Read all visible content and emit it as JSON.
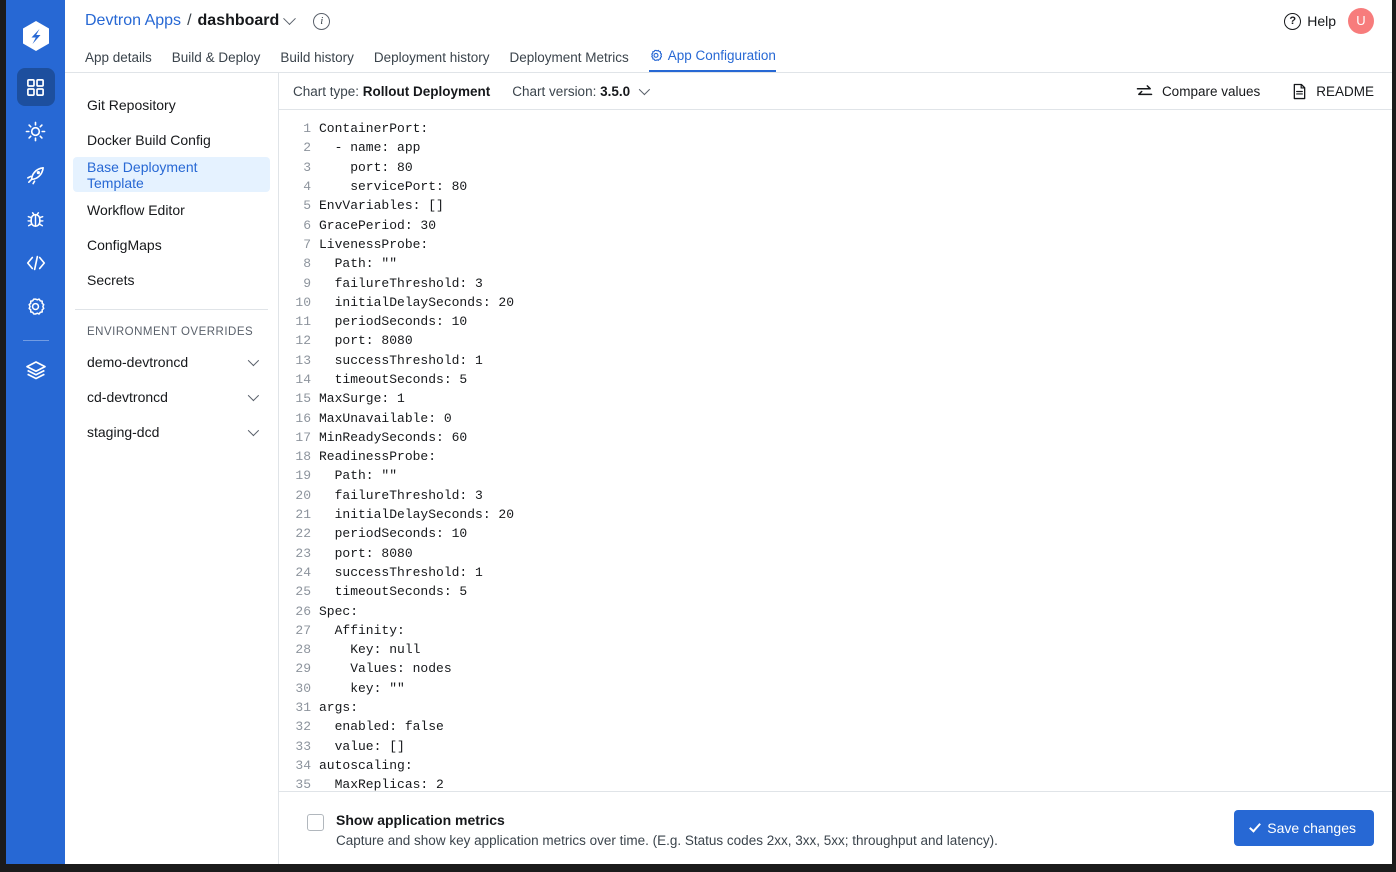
{
  "window": {
    "title": "Devtron Apps / dashboard"
  },
  "rail": {
    "logo_icon": "devtron-logo",
    "items": [
      {
        "icon": "grid-apps-icon",
        "name": "applications",
        "active": true
      },
      {
        "icon": "helm-chart-icon",
        "name": "chart-store",
        "active": false
      },
      {
        "icon": "rocket-icon",
        "name": "deployment-groups",
        "active": false
      },
      {
        "icon": "bug-icon",
        "name": "security",
        "active": false
      },
      {
        "icon": "code-icon",
        "name": "bulk-edit",
        "active": false
      },
      {
        "icon": "gear-icon",
        "name": "global-configurations",
        "active": false
      },
      {
        "icon": "stack-layers-icon",
        "name": "stack-manager",
        "active": false
      }
    ]
  },
  "header": {
    "breadcrumb_root": "Devtron Apps",
    "breadcrumb_separator": "/",
    "breadcrumb_current": "dashboard",
    "dropdown_icon": "chevron-down-icon",
    "info_icon": "info-icon",
    "info_glyph": "i",
    "help_label": "Help",
    "help_glyph": "?",
    "avatar_initial": "U",
    "avatar_color": "#f77c7c"
  },
  "tabs": [
    {
      "label": "App details",
      "active": false
    },
    {
      "label": "Build & Deploy",
      "active": false
    },
    {
      "label": "Build history",
      "active": false
    },
    {
      "label": "Deployment history",
      "active": false
    },
    {
      "label": "Deployment Metrics",
      "active": false
    },
    {
      "label": "App Configuration",
      "active": true,
      "icon": "gear-icon"
    }
  ],
  "config_nav": {
    "items": [
      {
        "label": "Git Repository",
        "active": false
      },
      {
        "label": "Docker Build Config",
        "active": false
      },
      {
        "label": "Base Deployment Template",
        "active": true
      },
      {
        "label": "Workflow Editor",
        "active": false
      },
      {
        "label": "ConfigMaps",
        "active": false
      },
      {
        "label": "Secrets",
        "active": false
      }
    ],
    "section_title": "ENVIRONMENT OVERRIDES",
    "environments": [
      {
        "label": "demo-devtroncd"
      },
      {
        "label": "cd-devtroncd"
      },
      {
        "label": "staging-dcd"
      }
    ]
  },
  "chart_header": {
    "type_label": "Chart type:",
    "type_value": "Rollout Deployment",
    "version_label": "Chart version:",
    "version_value": "3.5.0",
    "version_dropdown_icon": "chevron-down-icon",
    "compare_label": "Compare values",
    "compare_icon": "compare-arrows-icon",
    "readme_label": "README",
    "readme_icon": "document-icon"
  },
  "editor": {
    "language": "yaml",
    "lines": [
      "ContainerPort:",
      "  - name: app",
      "    port: 80",
      "    servicePort: 80",
      "EnvVariables: []",
      "GracePeriod: 30",
      "LivenessProbe:",
      "  Path: \"\"",
      "  failureThreshold: 3",
      "  initialDelaySeconds: 20",
      "  periodSeconds: 10",
      "  port: 8080",
      "  successThreshold: 1",
      "  timeoutSeconds: 5",
      "MaxSurge: 1",
      "MaxUnavailable: 0",
      "MinReadySeconds: 60",
      "ReadinessProbe:",
      "  Path: \"\"",
      "  failureThreshold: 3",
      "  initialDelaySeconds: 20",
      "  periodSeconds: 10",
      "  port: 8080",
      "  successThreshold: 1",
      "  timeoutSeconds: 5",
      "Spec:",
      "  Affinity:",
      "    Key: null",
      "    Values: nodes",
      "    key: \"\"",
      "args:",
      "  enabled: false",
      "  value: []",
      "autoscaling:",
      "  MaxReplicas: 2"
    ]
  },
  "footer": {
    "checkbox_label": "Show application metrics",
    "checkbox_checked": false,
    "description": "Capture and show key application metrics over time. (E.g. Status codes 2xx, 3xx, 5xx; throughput and latency).",
    "save_label": "Save changes",
    "save_icon": "check-icon",
    "save_color": "#2768d4"
  }
}
